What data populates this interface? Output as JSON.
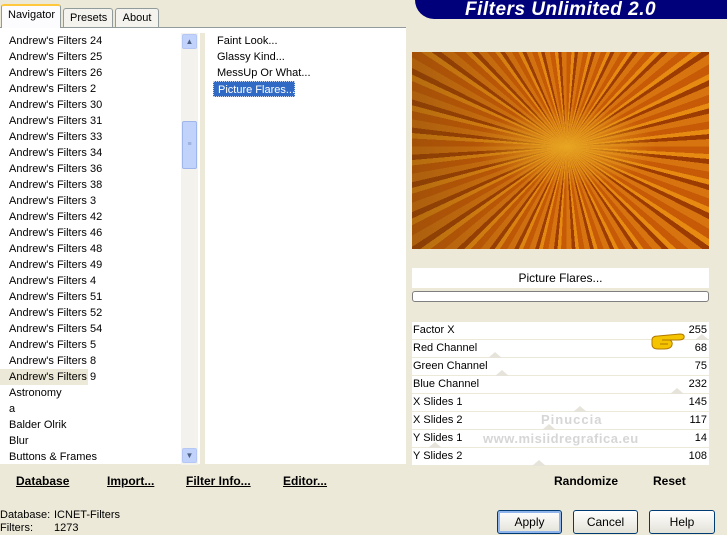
{
  "tabs": [
    {
      "label": "Navigator",
      "active": true
    },
    {
      "label": "Presets",
      "active": false
    },
    {
      "label": "About",
      "active": false
    }
  ],
  "banner": {
    "title": "Filters Unlimited 2.0"
  },
  "categories": {
    "items": [
      "Andrew's Filters 24",
      "Andrew's Filters 25",
      "Andrew's Filters 26",
      "Andrew's Filters 2",
      "Andrew's Filters 30",
      "Andrew's Filters 31",
      "Andrew's Filters 33",
      "Andrew's Filters 34",
      "Andrew's Filters 36",
      "Andrew's Filters 38",
      "Andrew's Filters 3",
      "Andrew's Filters 42",
      "Andrew's Filters 46",
      "Andrew's Filters 48",
      "Andrew's Filters 49",
      "Andrew's Filters 4",
      "Andrew's Filters 51",
      "Andrew's Filters 52",
      "Andrew's Filters 54",
      "Andrew's Filters 5",
      "Andrew's Filters 8",
      "Andrew's Filters 9",
      "Astronomy",
      "a",
      "Balder Olrik",
      "Blur",
      "Buttons & Frames"
    ],
    "selected": "Andrew's Filters 9"
  },
  "filters": {
    "items": [
      "Faint Look...",
      "Glassy Kind...",
      "MessUp Or What...",
      "Picture Flares..."
    ],
    "selected": "Picture Flares..."
  },
  "links": {
    "database": "Database",
    "import": "Import...",
    "filter_info": "Filter Info...",
    "editor": "Editor..."
  },
  "preview": {
    "filter_name": "Picture Flares...",
    "colors": {
      "deep": "#9c3c02",
      "mid": "#c75a06",
      "light": "#e8a622"
    }
  },
  "params": [
    {
      "label": "Factor X",
      "value": "255",
      "fraction": 1.0
    },
    {
      "label": "Red Channel",
      "value": "68",
      "fraction": 0.267
    },
    {
      "label": "Green Channel",
      "value": "75",
      "fraction": 0.294
    },
    {
      "label": "Blue Channel",
      "value": "232",
      "fraction": 0.91
    },
    {
      "label": "X Slides 1",
      "value": "145",
      "fraction": 0.569
    },
    {
      "label": "X Slides 2",
      "value": "117",
      "fraction": 0.459
    },
    {
      "label": "Y Slides 1",
      "value": "14",
      "fraction": 0.055
    },
    {
      "label": "Y Slides 2",
      "value": "108",
      "fraction": 0.424
    }
  ],
  "watermark": {
    "line1": "Pinuccia",
    "line2": "www.misiidregrafica.eu"
  },
  "actions": {
    "randomize": "Randomize",
    "reset": "Reset"
  },
  "info": {
    "database_label": "Database:",
    "database_value": "ICNET-Filters",
    "filters_label": "Filters:",
    "filters_value": "1273"
  },
  "buttons": {
    "apply": "Apply",
    "cancel": "Cancel",
    "help": "Help"
  }
}
